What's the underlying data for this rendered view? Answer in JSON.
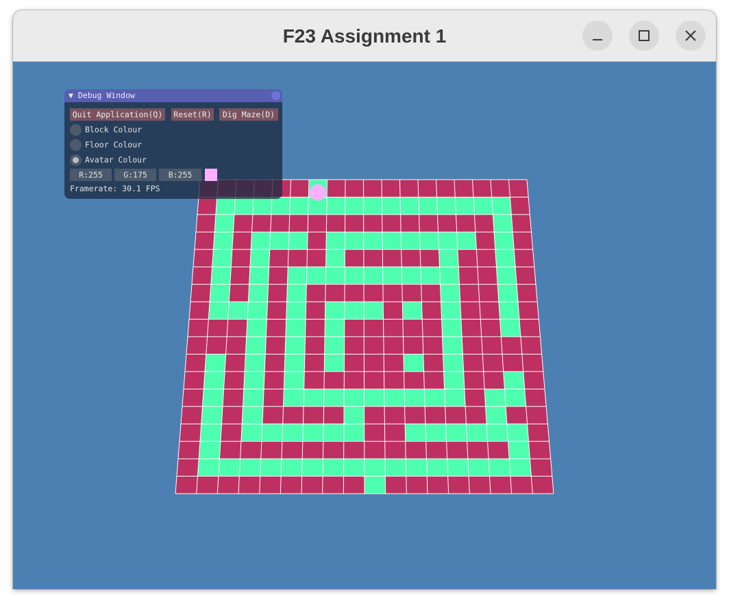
{
  "window": {
    "title": "F23 Assignment 1",
    "controls": [
      "minimize",
      "maximize",
      "close"
    ]
  },
  "debug_window": {
    "title": "▼ Debug Window",
    "buttons": [
      "Quit Application(Q)",
      "Reset(R)",
      "Dig Maze(D)"
    ],
    "radio_options": [
      "Block Colour",
      "Floor Colour",
      "Avatar Colour"
    ],
    "selected_option": "Avatar Colour",
    "color_fields": [
      "R:255",
      "G:175",
      "B:255"
    ],
    "framerate": "Framerate: 30.1 FPS"
  },
  "colors": {
    "background": "#4c80b2",
    "block": "#bd3061",
    "floor": "#4effaf",
    "avatar": "#ffafff",
    "grid": "#ffffff"
  },
  "maze": {
    "grid_size": 18,
    "cells": [
      "BBBBBBFBBBBBBBBBBB",
      "BFFFFFFFFFFFFFFFFB",
      "BFBBBBBBBBBBBBBBFB",
      "BFBFFFBFFFFFFFFBFB",
      "BFBFBBBFBBBBBFBBFB",
      "BFBFBFFFFFFFFFBBFB",
      "BFBFBFBBBBBBBFBBFB",
      "BFFFBFBFFFBFBFBBFB",
      "BBBFBFBFBBBBBFBBFB",
      "BBBFBFBFBBBBBFBBBB",
      "BFBFBFBFBBBFBFBBBB",
      "BFBFBFBBBBBBBFBBFB",
      "BFBFBFFFFFFFFFBFFB",
      "BFBFBBBBFBBBBBBFBB",
      "BFBFFFFFFBBFFFFFFB",
      "BFBBBBBBBBBBBBBBFB",
      "BFFFFFFFFFFFFFFFFB",
      "BBBBBBBBBFBBBBBBBB"
    ],
    "avatar": {
      "row": 0,
      "col": 6
    }
  }
}
